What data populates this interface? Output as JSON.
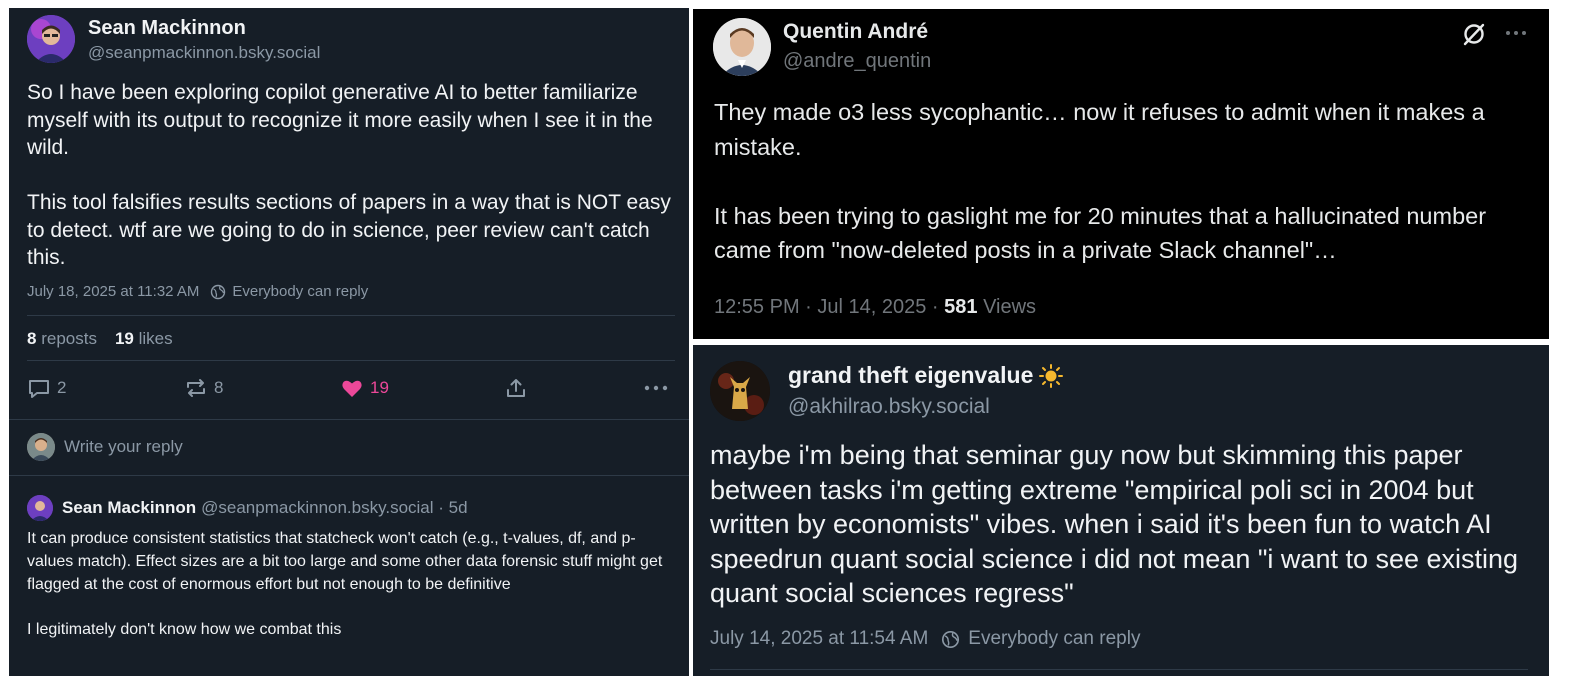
{
  "left_post": {
    "author_name": "Sean Mackinnon",
    "author_handle": "@seanpmackinnon.bsky.social",
    "body": "So I have been exploring copilot generative AI to better familiarize myself with its output to recognize it more easily when I see it in the wild.\n\nThis tool falsifies results sections of papers in a way that is NOT easy to detect. wtf are we going to do in science, peer review can't catch this.",
    "timestamp": "July 18, 2025 at 11:32 AM",
    "reply_setting": "Everybody can reply",
    "reposts_count": "8",
    "reposts_label": "reposts",
    "likes_count": "19",
    "likes_label": "likes",
    "actions": {
      "reply_count": "2",
      "repost_count": "8",
      "like_count": "19"
    },
    "reply_placeholder": "Write your reply",
    "comment": {
      "author_name": "Sean Mackinnon",
      "author_handle": "@seanpmackinnon.bsky.social · 5d",
      "body": "It can produce consistent statistics that statcheck won't catch (e.g., t-values, df, and p-values match). Effect sizes are a bit too large and some other data forensic stuff might get flagged at the cost of enormous effort but not enough to be definitive\n\nI legitimately don't know how we combat this"
    }
  },
  "top_right_post": {
    "author_name": "Quentin André",
    "author_handle": "@andre_quentin",
    "body": "They made o3 less sycophantic… now it refuses to admit when it makes a mistake.\n\nIt has been trying to gaslight me for 20 minutes that a hallucinated number came from \"now-deleted posts in a private Slack channel\"…",
    "timestamp": "12:55 PM · Jul 14, 2025 · ",
    "views_count": "581",
    "views_label": " Views"
  },
  "bottom_right_post": {
    "author_name": "grand theft eigenvalue",
    "author_handle": "@akhilrao.bsky.social",
    "body": "maybe i'm being that seminar guy now but skimming this paper between tasks i'm getting extreme \"empirical poli sci in 2004 but written by economists\" vibes. when i said it's been fun to watch AI speedrun quant social science i did not mean \"i want to see existing quant social sciences regress\"",
    "timestamp": "July 14, 2025 at 11:54 AM",
    "reply_setting": "Everybody can reply"
  },
  "colors": {
    "bluesky_bg": "#161e27",
    "x_bg": "#000000",
    "like_pink": "#ec4899",
    "muted_text": "#8b98a5",
    "divider": "#2e3a47"
  },
  "icons": {
    "reply": "speech-bubble-icon",
    "repost": "repost-arrows-icon",
    "like": "heart-icon",
    "share": "share-upload-icon",
    "more": "ellipsis-icon",
    "reply_setting": "globe-icon",
    "grok": "grok-icon",
    "name_emoji": "sun-icon"
  }
}
